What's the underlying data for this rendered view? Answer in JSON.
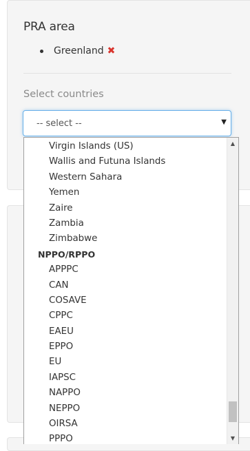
{
  "pra_area": {
    "title": "PRA area",
    "items": [
      {
        "label": "Greenland",
        "remove_icon": "close-icon"
      }
    ]
  },
  "country_select": {
    "label": "Select countries",
    "selected": "-- select --",
    "caret_icon": "caret-down-icon"
  },
  "dropdown": {
    "country_options": [
      "Virgin Islands (US)",
      "Wallis and Futuna Islands",
      "Western Sahara",
      "Yemen",
      "Zaire",
      "Zambia",
      "Zimbabwe"
    ],
    "group_label": "NPPO/RPPO",
    "group_options": [
      "APPPC",
      "CAN",
      "COSAVE",
      "CPPC",
      "EAEU",
      "EPPO",
      "EU",
      "IAPSC",
      "NAPPO",
      "NEPPO",
      "OIRSA",
      "PPPO"
    ],
    "scroll_position": 0.96
  },
  "colors": {
    "remove_icon": "#d9352e",
    "focus_border": "#66afe9",
    "panel_bg": "#f5f5f5"
  }
}
